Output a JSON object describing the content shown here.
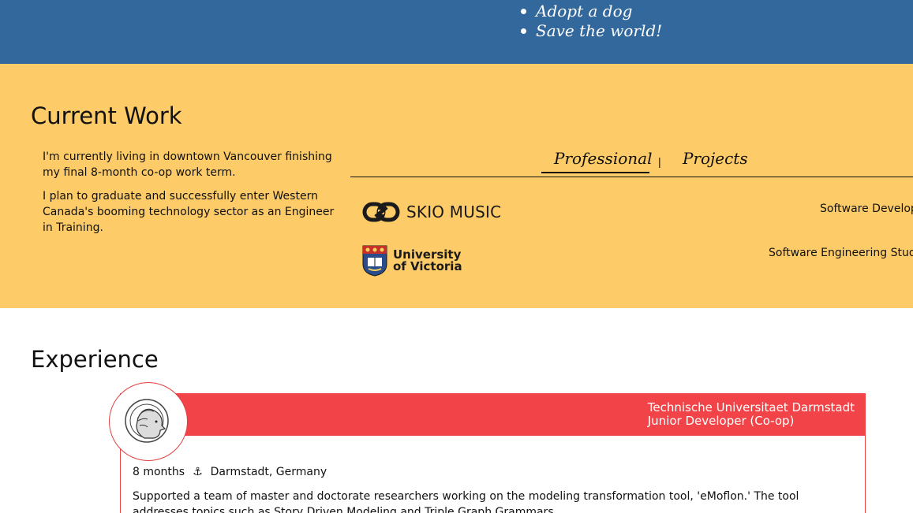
{
  "goals": [
    "Adopt a dog",
    "Save the world!"
  ],
  "current_work": {
    "title": "Current Work",
    "paragraphs": [
      "I'm currently living in downtown Vancouver finishing my final 8-month co-op work term.",
      "I plan to graduate and successfully enter Western Canada's booming technology sector as an Engineer in Training."
    ],
    "tabs": {
      "professional": "Professional",
      "separator": "|",
      "projects": "Projects"
    },
    "entries": [
      {
        "logo_text": "SKIO MUSIC",
        "logo_icon": "skio-logo-icon",
        "role": "Software Develope"
      },
      {
        "logo_text_1": "University",
        "logo_text_2": "of Victoria",
        "logo_icon": "uvic-crest-icon",
        "role": "Software Engineering Studer"
      }
    ]
  },
  "experience": {
    "title": "Experience",
    "cards": [
      {
        "company": "Technische Universitaet Darmstadt",
        "position": "Junior Developer (Co-op)",
        "duration": "8 months",
        "location": "Darmstadt, Germany",
        "description": "Supported a team of master and doctorate researchers working on the modeling transformation tool, 'eMoflon.' The tool addresses topics such as Story Driven Modeling and Triple Graph Grammars.",
        "header_color": "#f24448",
        "avatar_icon": "athena-head-icon"
      }
    ]
  },
  "colors": {
    "blue": "#33689c",
    "yellow": "#fdcb67",
    "red": "#f24448"
  }
}
